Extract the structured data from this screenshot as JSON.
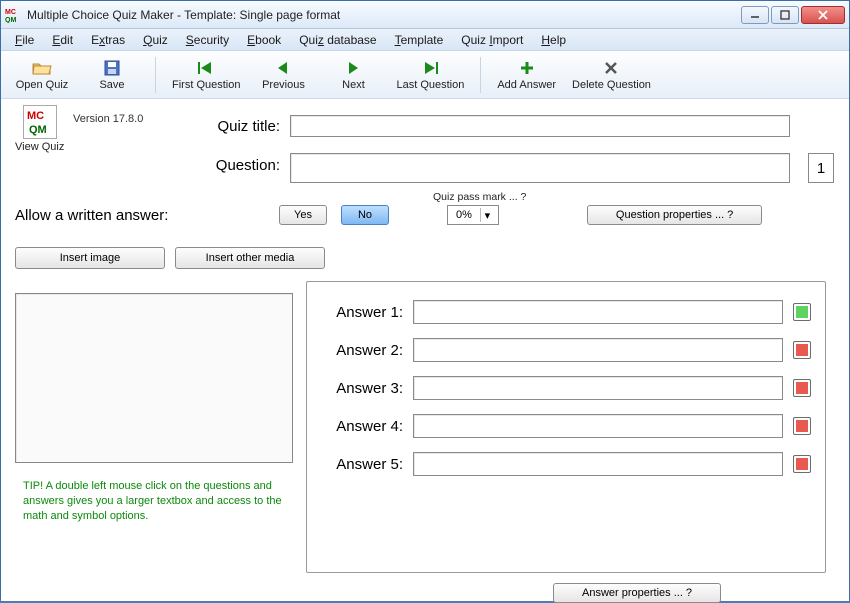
{
  "window": {
    "title": "Multiple Choice Quiz Maker - Template: Single page format"
  },
  "menu": {
    "file": "File",
    "edit": "Edit",
    "extras": "Extras",
    "quiz": "Quiz",
    "security": "Security",
    "ebook": "Ebook",
    "quiz_database": "Quiz database",
    "template": "Template",
    "quiz_import": "Quiz Import",
    "help": "Help"
  },
  "toolbar": {
    "open_quiz": "Open Quiz",
    "save": "Save",
    "first_question": "First Question",
    "previous": "Previous",
    "next": "Next",
    "last_question": "Last Question",
    "add_answer": "Add Answer",
    "delete_question": "Delete Question"
  },
  "sidebar": {
    "view_quiz": "View Quiz",
    "version": "Version 17.8.0"
  },
  "labels": {
    "quiz_title": "Quiz title:",
    "question": "Question:",
    "question_number": "1",
    "pass_mark": "Quiz pass mark ... ?",
    "allow_written": "Allow a written answer:",
    "yes": "Yes",
    "no": "No",
    "pass_value": "0%",
    "question_properties": "Question properties ... ?",
    "insert_image": "Insert image",
    "insert_other_media": "Insert other media",
    "answer_properties": "Answer properties ... ?"
  },
  "answers": {
    "a1": "Answer 1:",
    "a2": "Answer 2:",
    "a3": "Answer 3:",
    "a4": "Answer 4:",
    "a5": "Answer 5:"
  },
  "values": {
    "quiz_title": "",
    "question": "",
    "a1": "",
    "a2": "",
    "a3": "",
    "a4": "",
    "a5": ""
  },
  "tip": "TIP! A double left mouse click on the questions and answers gives you a larger textbox and access to the math and symbol options."
}
